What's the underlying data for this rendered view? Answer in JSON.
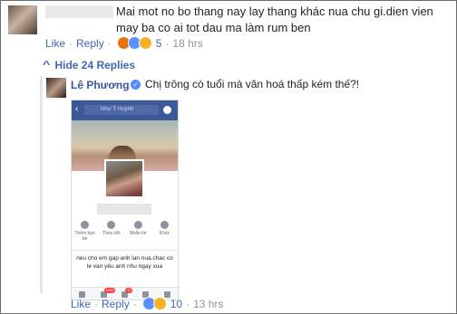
{
  "comment1": {
    "text": "Mai mot no bo thang nay lay thang khác nua chu gi.dien vien may ba co ai tot dau ma làm rum ben",
    "like_label": "Like",
    "reply_label": "Reply",
    "reaction_count": "5",
    "timestamp": "18 hrs"
  },
  "replies_toggle": {
    "label": "Hide 24 Replies"
  },
  "comment2": {
    "author": "Lê Phương",
    "text": "Chị trông có tuổi mà văn hoá thấp kém thế?!",
    "like_label": "Like",
    "reply_label": "Reply",
    "reaction_count": "10",
    "timestamp": "13 hrs",
    "screenshot": {
      "search_text": "Như Ý Huỳnh",
      "actions": [
        "Thêm bạn bè",
        "Theo dõi",
        "Nhắn tin",
        "Khác"
      ],
      "post_text": "neu cho em gap anh lan nua.chac co le van yêu anh nhu ngay xua",
      "badge_count": "1000",
      "badge_count_2": "12"
    }
  },
  "colors": {
    "link": "#4267b2",
    "meta": "#90949c",
    "fb_blue": "#3b5998",
    "verified": "#4f8aff"
  }
}
